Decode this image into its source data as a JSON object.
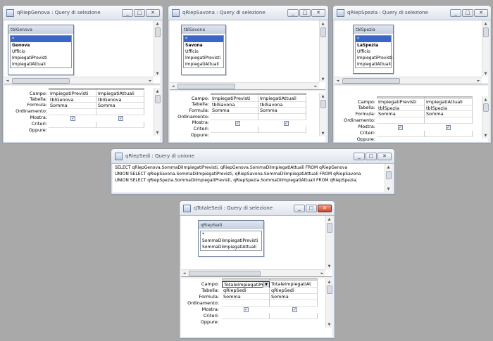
{
  "windows": {
    "genova": {
      "title": "qRiepGenova : Query di selezione",
      "table": {
        "name": "tblGenova",
        "fields": [
          "*",
          "Genova",
          "Ufficio",
          "ImpiegatiPrevisti",
          "ImpiegatiAttuali"
        ]
      },
      "labels": [
        "Campo:",
        "Tabella:",
        "Formula:",
        "Ordinamento:",
        "Mostra:",
        "Criteri:",
        "Oppure:"
      ],
      "columns": [
        {
          "campo": "ImpiegatiPrevisti",
          "tabella": "tblGenova",
          "formula": "Somma",
          "mostra": "✓"
        },
        {
          "campo": "ImpiegatiAttuali",
          "tabella": "tblGenova",
          "formula": "Somma",
          "mostra": "✓"
        }
      ]
    },
    "savona": {
      "title": "qRiepSavona : Query di selezione",
      "table": {
        "name": "tblSavona",
        "fields": [
          "*",
          "Savona",
          "Ufficio",
          "ImpiegatiPrevisti",
          "ImpiegatiAttuali"
        ]
      },
      "labels": [
        "Campo:",
        "Tabella:",
        "Formula:",
        "Ordinamento:",
        "Mostra:",
        "Criteri:",
        "Oppure:"
      ],
      "columns": [
        {
          "campo": "ImpiegatiPrevisti",
          "tabella": "tblSavona",
          "formula": "Somma",
          "mostra": "✓"
        },
        {
          "campo": "ImpiegatiAttuali",
          "tabella": "tblSavona",
          "formula": "Somma",
          "mostra": "✓"
        }
      ]
    },
    "spezia": {
      "title": "qRiepSpezia : Query di selezione",
      "table": {
        "name": "tblSpezia",
        "fields": [
          "*",
          "LaSpezia",
          "Ufficio",
          "ImpiegatiPrevisti",
          "ImpiegatiAttuali"
        ]
      },
      "labels": [
        "Campo:",
        "Tabella:",
        "Formula:",
        "Ordinamento:",
        "Mostra:",
        "Criteri:",
        "Oppure:"
      ],
      "columns": [
        {
          "campo": "ImpiegatiPrevisti",
          "tabella": "tblSpezia",
          "formula": "Somma",
          "mostra": "✓"
        },
        {
          "campo": "ImpiegatiAttuali",
          "tabella": "tblSpezia",
          "formula": "Somma",
          "mostra": "✓"
        }
      ]
    },
    "sedi": {
      "title": "qRiepSedi : Query di unione",
      "sql": [
        "SELECT qRiepGenova.SommaDiImpiegatiPrevisti, qRiepGenova.SommaDiImpiegatiAttuali FROM qRiepGenova",
        "UNION SELECT qRiepSavona.SommaDiImpiegatiPrevisti, qRiepSavona.SommaDiImpiegatiAttuali FROM qRiepSavona",
        "UNION SELECT qRiepSpezia.SommaDiImpiegatiPrevisti, qRiepSpezia.SommaDiImpiegatiAttuali FROM qRiepSpezia;"
      ]
    },
    "totale": {
      "title": "qTotaleSedi : Query di selezione",
      "table": {
        "name": "qRiepSedi",
        "fields": [
          "*",
          "SommaDiImpiegatiPrevisti",
          "SommaDiImpiegatiAttuali"
        ]
      },
      "labels": [
        "Campo:",
        "Tabella:",
        "Formula:",
        "Ordinamento:",
        "Mostra:",
        "Criteri:",
        "Oppure:"
      ],
      "columns": [
        {
          "campo": "TotaleImpiegatiPr",
          "tabella": "qRiepSedi",
          "formula": "Somma",
          "mostra": "✓"
        },
        {
          "campo": "TotaleImpiegatiAt",
          "tabella": "qRiepSedi",
          "formula": "Somma",
          "mostra": "✓"
        }
      ]
    }
  },
  "buttons": {
    "minimize": "_",
    "maximize": "□",
    "close": "✕"
  },
  "scroll": {
    "up": "▲",
    "down": "▼",
    "left": "◄",
    "right": "►",
    "dropdown": "▼"
  }
}
